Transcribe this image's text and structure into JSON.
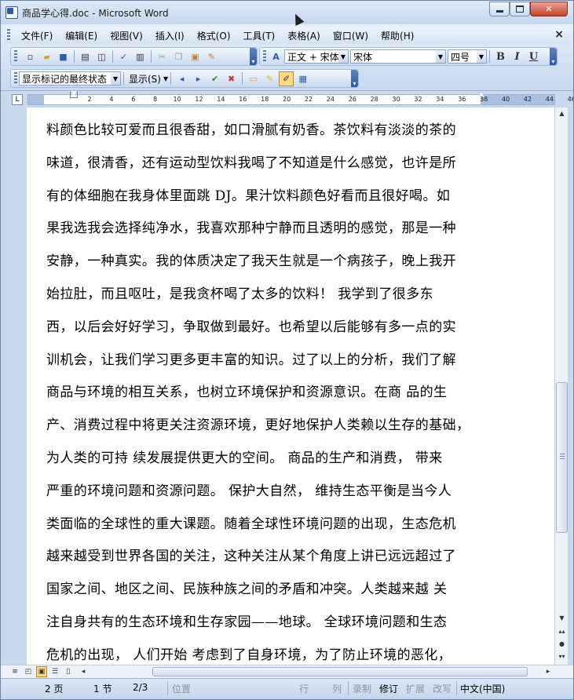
{
  "window": {
    "title": "商品学心得.doc - Microsoft Word"
  },
  "menubar": {
    "items": [
      "文件(F)",
      "编辑(E)",
      "视图(V)",
      "插入(I)",
      "格式(O)",
      "工具(T)",
      "表格(A)",
      "窗口(W)",
      "帮助(H)"
    ],
    "close_glyph": "×"
  },
  "format_toolbar": {
    "style_value": "正文 + 宋体",
    "font_value": "宋体",
    "size_value": "四号",
    "bold": "B",
    "italic": "I",
    "underline": "U"
  },
  "review_toolbar": {
    "show_markup_value": "显示标记的最终状态",
    "show_label": "显示(S)"
  },
  "ruler": {
    "ticks": [
      "2",
      "4",
      "6",
      "8",
      "10",
      "12",
      "14",
      "16",
      "18",
      "20",
      "22",
      "24",
      "26",
      "28",
      "30",
      "32",
      "34",
      "36",
      "38",
      "40",
      "42",
      "44",
      "46"
    ]
  },
  "document": {
    "lines": [
      "料颜色比较可爱而且很香甜，如口滑腻有奶香。茶饮料有淡淡的茶的",
      "味道，很清香，还有运动型饮料我喝了不知道是什么感觉，也许是所",
      "有的体细胞在我身体里面跳 DJ。果汁饮料颜色好看而且很好喝。如",
      "果我选我会选择纯净水，我喜欢那种宁静而且透明的感觉，那是一种",
      "安静，一种真实。我的体质决定了我天生就是一个病孩子，晚上我开",
      "始拉肚，而且呕吐，是我贪杯喝了太多的饮料！     我学到了很多东",
      "西，以后会好好学习，争取做到最好。也希望以后能够有多一点的实",
      "训机会，让我们学习更多更丰富的知识。过了以上的分析，我们了解",
      "商品与环境的相互关系，也树立环境保护和资源意识。在商  品的生",
      "产、消费过程中将更关注资源环境，更好地保护人类赖以生存的基础，",
      "为人类的可持  续发展提供更大的空间。  商品的生产和消费，  带来",
      "严重的环境问题和资源问题。  保护大自然，  维持生态平衡是当今人",
      "类面临的全球性的重大课题。随着全球性环境问题的出现，生态危机",
      "越来越受到世界各国的关注，这种关注从某个角度上讲已远远超过了",
      "国家之间、地区之间、民族种族之间的矛盾和冲突。人类越来越  关",
      "注自身共有的生态环境和生存家园——地球。  全球环境问题和生态",
      "危机的出现，  人们开始  考虑到了自身环境，为了防止环境的恶化，"
    ]
  },
  "status": {
    "page": "2 页",
    "section": "1 节",
    "page_of": "2/3",
    "position": "位置",
    "line": "行",
    "column": "列",
    "rec": "录制",
    "trk": "修订",
    "ext": "扩展",
    "ovr": "改写",
    "language": "中文(中国)"
  }
}
